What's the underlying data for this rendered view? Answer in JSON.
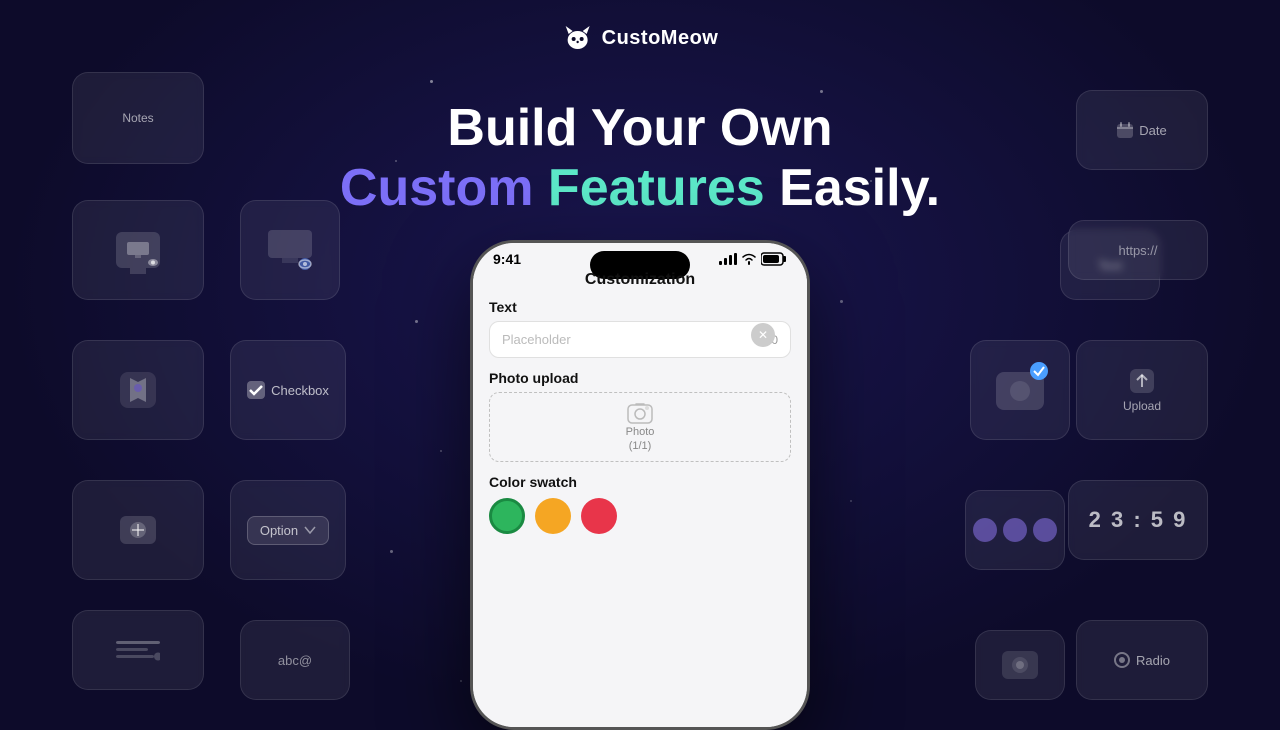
{
  "app": {
    "name": "CustoMeow"
  },
  "hero": {
    "line1": "Build Your Own",
    "line2_part1": "Custom",
    "line2_part2": "Features",
    "line2_part3": "Easily."
  },
  "phone": {
    "status_time": "9:41",
    "title": "Customization",
    "text_label": "Text",
    "text_placeholder": "Placeholder",
    "char_count": "0/20",
    "photo_upload_label": "Photo upload",
    "photo_label": "Photo",
    "photo_count": "(1/1)",
    "color_swatch_label": "Color swatch"
  },
  "cards": {
    "notes": "Notes",
    "checkbox": "Checkbox",
    "option": "Option",
    "date": "Date",
    "text": "Text",
    "url": "https://",
    "upload": "Upload",
    "radio": "Radio",
    "abc": "abc@",
    "timer": "2 3 : 5 9"
  }
}
